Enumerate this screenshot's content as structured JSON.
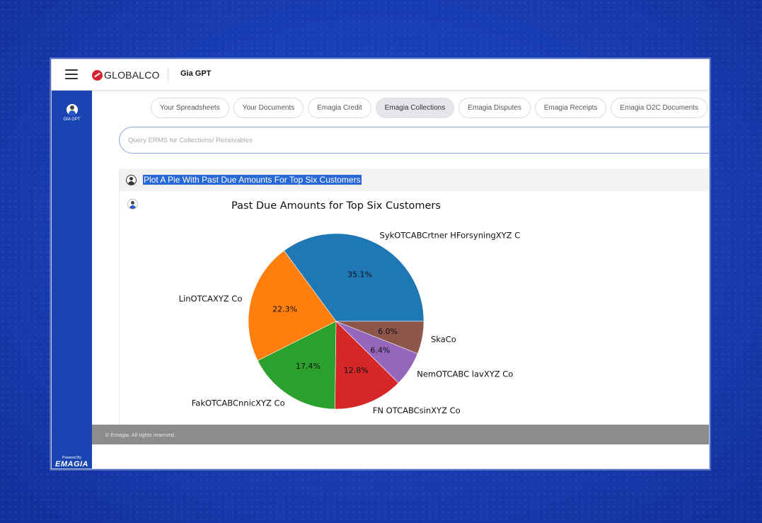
{
  "header": {
    "logo_text": "GLOBALCO",
    "app_title": "Gia GPT"
  },
  "sidebar": {
    "item_label": "GIA GPT",
    "powered_by": "Powered By",
    "brand": "EMAGIA"
  },
  "tabs": [
    {
      "label": "Your Spreadsheets",
      "active": false
    },
    {
      "label": "Your Documents",
      "active": false
    },
    {
      "label": "Emagia Credit",
      "active": false
    },
    {
      "label": "Emagia Collections",
      "active": true
    },
    {
      "label": "Emagia Disputes",
      "active": false
    },
    {
      "label": "Emagia Receipts",
      "active": false
    },
    {
      "label": "Emagia O2C Documents",
      "active": false
    }
  ],
  "search": {
    "placeholder": "Query ERMS for Collections/ Receivables"
  },
  "chat": {
    "user_query": "Plot A Pie With Past Due Amounts For Top Six Customers"
  },
  "footer": {
    "text": "© Emagia. All rights reserved."
  },
  "chart_data": {
    "type": "pie",
    "title": "Past Due Amounts for Top Six Customers",
    "slices": [
      {
        "label": "SykOTCABCrtner HForsyningXYZ C",
        "value": 35.1,
        "pct_label": "35.1%",
        "color": "#1f77b4"
      },
      {
        "label": "LinOTCAXYZ Co",
        "value": 22.3,
        "pct_label": "22.3%",
        "color": "#ff7f0e"
      },
      {
        "label": "FakOTCABCnnicXYZ Co",
        "value": 17.4,
        "pct_label": "17.4%",
        "color": "#2ca02c"
      },
      {
        "label": "FN OTCABCsinXYZ Co",
        "value": 12.8,
        "pct_label": "12.8%",
        "color": "#d62728"
      },
      {
        "label": "NemOTCABC lavXYZ Co",
        "value": 6.4,
        "pct_label": "6.4%",
        "color": "#9467bd"
      },
      {
        "label": "SkaCo",
        "value": 6.0,
        "pct_label": "6.0%",
        "color": "#8c564b"
      }
    ],
    "start_angle": 0,
    "direction": "counterclockwise"
  }
}
